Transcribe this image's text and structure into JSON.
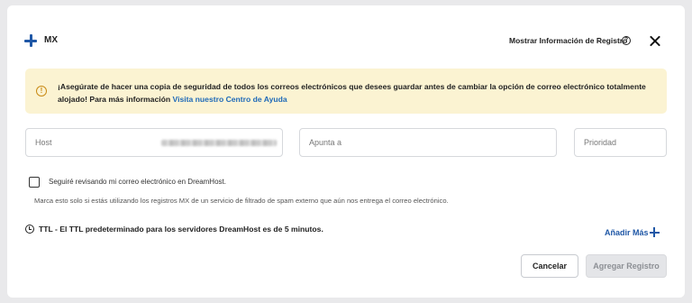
{
  "header": {
    "record_type": "MX",
    "show_info_label": "Mostrar Información de Registro",
    "help_icon_glyph": "?"
  },
  "alert": {
    "icon_glyph": "!",
    "message": "¡Asegúrate de hacer una copia de seguridad de todos los correos electrónicos que desees guardar antes de cambiar la opción de correo electrónico totalmente alojado! Para más información ",
    "link_text": "Visita nuestro Centro de Ayuda",
    "accent_color": "#c98a14",
    "background_color": "#fbf3d2"
  },
  "form": {
    "host_placeholder": "Host",
    "points_to_placeholder": "Apunta a",
    "priority_placeholder": "Prioridad",
    "keep_checking_label": "Seguiré revisando mi correo electrónico en DreamHost.",
    "keep_checking_checked": false,
    "keep_checking_help": "Marca esto solo si estás utilizando los registros MX de un servicio de filtrado de spam externo que aún nos entrega el correo electrónico."
  },
  "ttl": {
    "label": "TTL",
    "description": " - El TTL predeterminado para los servidores DreamHost es de 5 minutos."
  },
  "add_more_label": "Añadir Más",
  "buttons": {
    "cancel": "Cancelar",
    "add_record": "Agregar Registro"
  },
  "colors": {
    "primary_blue": "#1f57a6",
    "link_blue": "#1f6ab8",
    "disabled_button_bg": "#e4e5e8"
  },
  "icons": [
    "plus-icon",
    "help-icon",
    "close-icon",
    "warning-icon",
    "clock-icon",
    "add-more-plus-icon"
  ]
}
